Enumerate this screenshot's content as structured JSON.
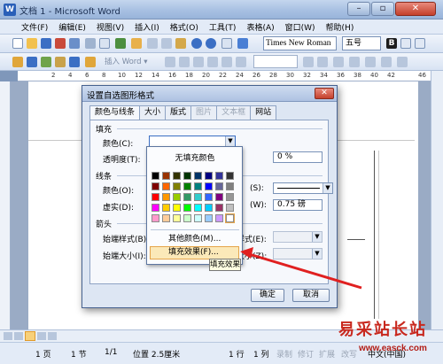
{
  "window": {
    "title": "文档 1 - Microsoft Word",
    "controls": {
      "min": "–",
      "max": "▫",
      "close": "✕"
    }
  },
  "menu": [
    "文件(F)",
    "编辑(E)",
    "视图(V)",
    "插入(I)",
    "格式(O)",
    "工具(T)",
    "表格(A)",
    "窗口(W)",
    "帮助(H)"
  ],
  "toolbar": {
    "font": "Times New Roman",
    "size": "五号",
    "drawing_label": "插入 Word ▾"
  },
  "ruler": [
    "2",
    "4",
    "6",
    "8",
    "10",
    "12",
    "14",
    "16",
    "18",
    "20",
    "22",
    "24",
    "26",
    "28",
    "30",
    "32",
    "34",
    "36",
    "38",
    "40",
    "42",
    "46"
  ],
  "dialog": {
    "title": "设置自选图形格式",
    "close": "✕",
    "tabs": [
      {
        "label": "颜色与线条",
        "state": "active"
      },
      {
        "label": "大小",
        "state": "normal"
      },
      {
        "label": "版式",
        "state": "normal"
      },
      {
        "label": "图片",
        "state": "disabled"
      },
      {
        "label": "文本框",
        "state": "disabled"
      },
      {
        "label": "网站",
        "state": "normal"
      }
    ],
    "fill": {
      "section": "填充",
      "color_label": "颜色(C):",
      "transparency_label": "透明度(T):",
      "transparency_value": "0 %"
    },
    "line": {
      "section": "线条",
      "color_label": "颜色(O):",
      "dash_label": "虚实(D):",
      "style_label": "(S):",
      "weight_label": "(W):",
      "weight_value": "0.75 磅"
    },
    "arrows": {
      "section": "箭头",
      "begin_style_label": "始端样式(B):",
      "begin_size_label": "始端大小(I):",
      "end_style_label": "样式(E):",
      "end_size_label": "大小(Z):"
    },
    "ok": "确定",
    "cancel": "取消"
  },
  "picker": {
    "no_fill": "无填充颜色",
    "more_colors": "其他颜色(M)...",
    "fill_effects": "填充效果(F)...",
    "tooltip": "填充效果",
    "colors": [
      [
        "#000000",
        "#993300",
        "#333300",
        "#003300",
        "#003366",
        "#000080",
        "#333399",
        "#333333"
      ],
      [
        "#800000",
        "#FF6600",
        "#808000",
        "#008000",
        "#008080",
        "#0000FF",
        "#666699",
        "#808080"
      ],
      [
        "#FF0000",
        "#FF9900",
        "#99CC00",
        "#339966",
        "#33CCCC",
        "#3366FF",
        "#800080",
        "#969696"
      ],
      [
        "#FF00FF",
        "#FFCC00",
        "#FFFF00",
        "#00FF00",
        "#00FFFF",
        "#00CCFF",
        "#993366",
        "#C0C0C0"
      ],
      [
        "#FF99CC",
        "#FFCC99",
        "#FFFF99",
        "#CCFFCC",
        "#CCFFFF",
        "#99CCFF",
        "#CC99FF",
        "#FFFFFF"
      ]
    ]
  },
  "status": {
    "page": "1 页",
    "section": "1 节",
    "pages": "1/1",
    "position": "位置 2.5厘米",
    "line": "1 行",
    "col": "1 列",
    "rec": "录制",
    "rev": "修订",
    "ext": "扩展",
    "ovr": "改写",
    "lang": "中文(中国)"
  },
  "colors": {
    "accent": "#2a5fb8",
    "highlight": "#fbe9b9",
    "arrow": "#e02020"
  }
}
